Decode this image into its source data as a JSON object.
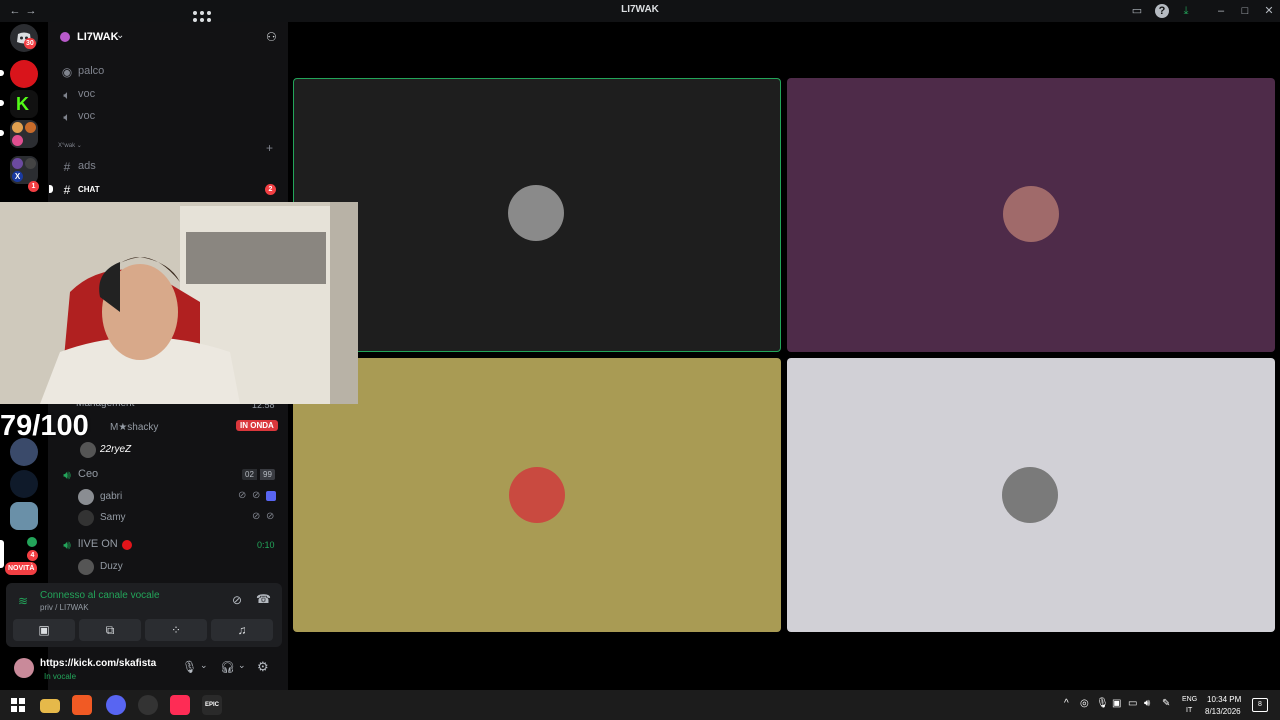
{
  "window": {
    "title": "LI7WAK"
  },
  "rail": {
    "home_badge": "30",
    "badge_x": "1",
    "badge_mid": "4",
    "novita_label": "NOVITÀ"
  },
  "sidebar": {
    "server_name": "LI7WAK",
    "channels": [
      {
        "icon": "stage",
        "label": "palco"
      },
      {
        "icon": "voice",
        "label": "voc"
      },
      {
        "icon": "voice",
        "label": "voc"
      }
    ],
    "category_label": "X°wak",
    "text_channels": [
      {
        "label": "ads",
        "active": false,
        "badge": ""
      },
      {
        "label": "CHAT",
        "active": true,
        "badge": "2"
      }
    ],
    "voice_section": {
      "partial_channel": "Management",
      "partial_timer": "12:58",
      "live_label": "IN ONDA",
      "live_user": "M★shacky",
      "sub_user": "22ryeZ",
      "ceo_channel": "Ceo",
      "ceo_counts": [
        "02",
        "99"
      ],
      "ceo_users": [
        "gabri",
        "Samy"
      ],
      "live_channel": "lIVE ON",
      "live_timer": "0:10",
      "live_users": [
        "Duzy"
      ]
    }
  },
  "stream_overlay": {
    "score_text": "79/100"
  },
  "voice_panel": {
    "status": "Connesso al canale vocale",
    "location": "priv / LI7WAK"
  },
  "user_panel": {
    "name": "https://kick.com/skafista",
    "status": "In vocale"
  },
  "stage": {
    "tiles": [
      {
        "bg": "#1e1e1e",
        "speaking": true,
        "avatar_color": "#8a8a8a"
      },
      {
        "bg": "#4e2b49",
        "speaking": false,
        "avatar_color": "#a06a6a"
      },
      {
        "bg": "#a99b54",
        "speaking": false,
        "avatar_color": "#c94a40"
      },
      {
        "bg": "#d1d0d6",
        "speaking": false,
        "avatar_color": "#7a7a7a"
      }
    ]
  },
  "taskbar": {
    "lang_top": "ENG",
    "lang_bottom": "IT",
    "time": "10:34 PM",
    "date": "8/13/2026",
    "notif_count": "8"
  },
  "colors": {
    "accent_green": "#23a55a",
    "danger": "#f23f43",
    "sidebar_bg": "#121214"
  }
}
